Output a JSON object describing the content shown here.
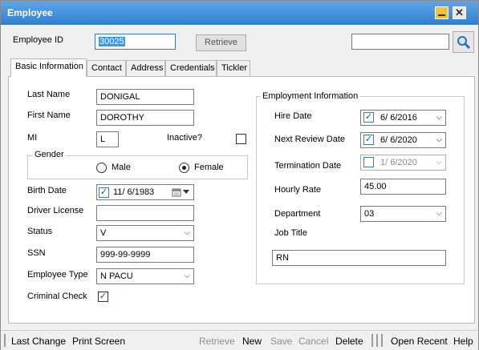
{
  "window": {
    "title": "Employee"
  },
  "header": {
    "employee_id_label": "Employee ID",
    "employee_id_value": "30025",
    "retrieve_button": "Retrieve",
    "search_value": ""
  },
  "tabs": [
    {
      "label": "Basic Information",
      "active": true
    },
    {
      "label": "Contact"
    },
    {
      "label": "Address"
    },
    {
      "label": "Credentials"
    },
    {
      "label": "Tickler"
    }
  ],
  "basic": {
    "last_name_label": "Last Name",
    "last_name": "DONIGAL",
    "first_name_label": "First Name",
    "first_name": "DOROTHY",
    "mi_label": "MI",
    "mi": "L",
    "inactive_label": "Inactive?",
    "inactive_checked": false,
    "gender_label": "Gender",
    "male_label": "Male",
    "female_label": "Female",
    "gender_selected": "Female",
    "birth_date_label": "Birth Date",
    "birth_date": "11/ 6/1983",
    "birth_date_checked": true,
    "driver_license_label": "Driver License",
    "driver_license": "",
    "status_label": "Status",
    "status": "V",
    "ssn_label": "SSN",
    "ssn": "999-99-9999",
    "employee_type_label": "Employee Type",
    "employee_type": "N PACU",
    "criminal_check_label": "Criminal Check",
    "criminal_check_checked": true
  },
  "employment": {
    "group_label": "Employment Information",
    "hire_date_label": "Hire Date",
    "hire_date": "6/ 6/2016",
    "hire_date_checked": true,
    "next_review_label": "Next Review Date",
    "next_review": "6/ 6/2020",
    "next_review_checked": true,
    "termination_label": "Termination Date",
    "termination": "1/ 6/2020",
    "termination_checked": false,
    "hourly_rate_label": "Hourly Rate",
    "hourly_rate": "45.00",
    "department_label": "Department",
    "department": "03",
    "job_title_label": "Job Title",
    "job_title": "RN"
  },
  "statusbar": {
    "last_change": "Last Change",
    "print_screen": "Print Screen",
    "retrieve": "Retrieve",
    "new": "New",
    "save": "Save",
    "cancel": "Cancel",
    "delete": "Delete",
    "open_recent": "Open Recent",
    "help": "Help"
  },
  "icons": {
    "checkmark": "✓",
    "chevron": "⌵",
    "close": "✕"
  }
}
